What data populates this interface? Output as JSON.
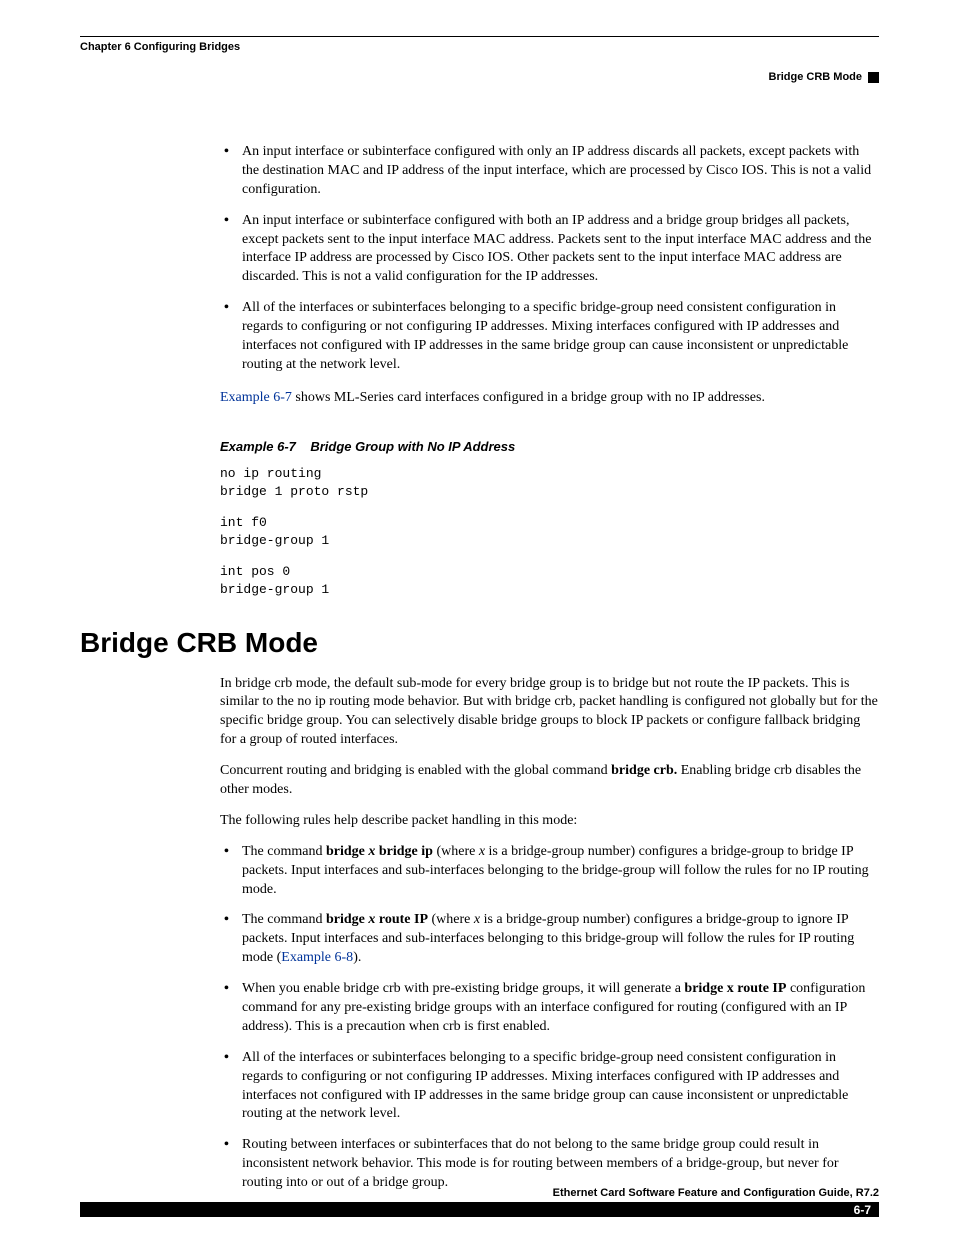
{
  "header": {
    "chapter": "Chapter 6      Configuring Bridges",
    "section": "Bridge CRB Mode"
  },
  "bullets_top": [
    "An input interface or subinterface configured with only an IP address discards all packets, except packets with the destination MAC and IP address of the input interface, which are processed by Cisco IOS. This is not a valid configuration.",
    "An input interface or subinterface configured with both an IP address and a bridge group bridges all packets, except packets sent to the input interface MAC address. Packets sent to the input interface MAC address and the interface IP address are processed by Cisco IOS. Other packets sent to the input interface MAC address are discarded. This is not a valid configuration for the IP addresses.",
    "All of the interfaces or subinterfaces belonging to a specific bridge-group need consistent configuration in regards to configuring or not configuring IP addresses. Mixing interfaces configured with IP addresses and interfaces not configured with IP addresses in the same bridge group can cause inconsistent or unpredictable routing at the network level."
  ],
  "link1_text": "Example 6-7",
  "after_link1": " shows ML-Series card interfaces configured in a bridge group with no IP addresses.",
  "example": {
    "caption_num": "Example 6-7",
    "caption_title": "Bridge Group with No IP Address",
    "block1": "no ip routing\nbridge 1 proto rstp",
    "block2": "int f0\nbridge-group 1",
    "block3": "int pos 0\nbridge-group 1"
  },
  "heading": "Bridge CRB Mode",
  "crb": {
    "p1": "In bridge crb mode, the default sub-mode for every bridge group is to bridge but not route the IP packets. This is similar to the no ip routing mode behavior. But with bridge crb, packet handling is configured not globally but for the specific bridge group. You can selectively disable bridge groups to block IP packets or configure fallback bridging for a group of routed interfaces.",
    "p2_a": "Concurrent routing and bridging is enabled with the global command ",
    "p2_b": "bridge crb.",
    "p2_c": " Enabling bridge crb disables the other modes.",
    "p3": "The following rules help describe packet handling in this mode:",
    "b1_a": "The command ",
    "b1_b": "bridge ",
    "b1_x": "x",
    "b1_c": " bridge ip",
    "b1_d": " (where ",
    "b1_e": " is a bridge-group number) configures a bridge-group to bridge IP packets. Input interfaces and sub-interfaces belonging to the bridge-group will follow the rules for no IP routing mode.",
    "b2_a": "The command ",
    "b2_b": "bridge ",
    "b2_c": " route IP",
    "b2_d": " (where ",
    "b2_e": " is a bridge-group number) configures a bridge-group to ignore IP packets. Input interfaces and sub-interfaces belonging to this bridge-group will follow the rules for IP routing mode (",
    "b2_link": "Example 6-8",
    "b2_f": ").",
    "b3_a": "When you enable bridge crb with pre-existing bridge groups, it will generate a ",
    "b3_b": "bridge x route IP",
    "b3_c": " configuration command for any pre-existing bridge groups with an interface configured for routing (configured with an IP address). This is a precaution when crb is first enabled.",
    "b4": "All of the interfaces or subinterfaces belonging to a specific bridge-group need consistent configuration in regards to configuring or not configuring IP addresses. Mixing interfaces configured with IP addresses and interfaces not configured with IP addresses in the same bridge group can cause inconsistent or unpredictable routing at the network level.",
    "b5": "Routing between interfaces or subinterfaces that do not belong to the same bridge group could result in inconsistent network behavior.  This mode is for routing between members of a bridge-group, but never for routing into or out of a bridge group."
  },
  "footer": {
    "title": "Ethernet Card Software Feature and Configuration Guide, R7.2",
    "page": "6-7"
  }
}
